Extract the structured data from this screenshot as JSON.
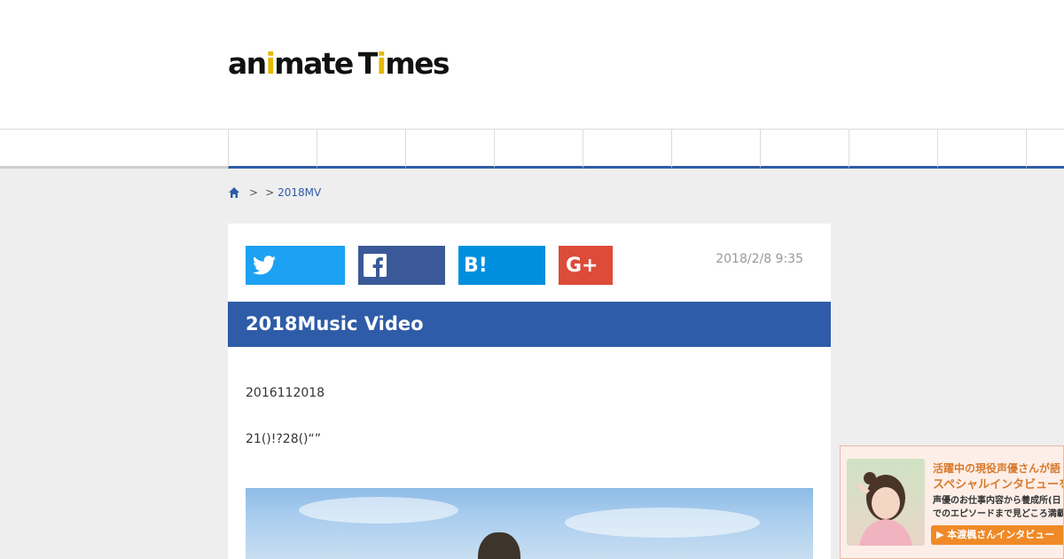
{
  "site": {
    "logo_part1": "an",
    "logo_dot": "i",
    "logo_part2": "mate",
    "logo_part3": "T",
    "logo_dot2": "i",
    "logo_part4": "mes"
  },
  "nav": {
    "item_count": 10
  },
  "breadcrumb": {
    "home_icon": "home-icon",
    "sep1": ">",
    "sep2": ">",
    "current": "2018MV"
  },
  "share": {
    "twitter_icon": "twitter-icon",
    "facebook_icon": "facebook-icon",
    "hatena_label": "B!",
    "gplus_label": "G+"
  },
  "article": {
    "date": "2018/2/8 9:35",
    "title": "2018Music Video",
    "para1": "2016112018",
    "para2": "21()!?28()“”"
  },
  "ad": {
    "line1": "活躍中の現役声優さんが語",
    "line2": "スペシャルインタビューを",
    "line3": "声優のお仕事内容から養成所(日",
    "line4": "でのエピソードまで見どころ満載",
    "button": "▶ 本渡楓さんインタビュー"
  },
  "colors": {
    "accent": "#2f5ca8",
    "twitter": "#1da1f2",
    "facebook": "#3b5998",
    "hatena": "#008fde",
    "gplus": "#dd4b39"
  }
}
